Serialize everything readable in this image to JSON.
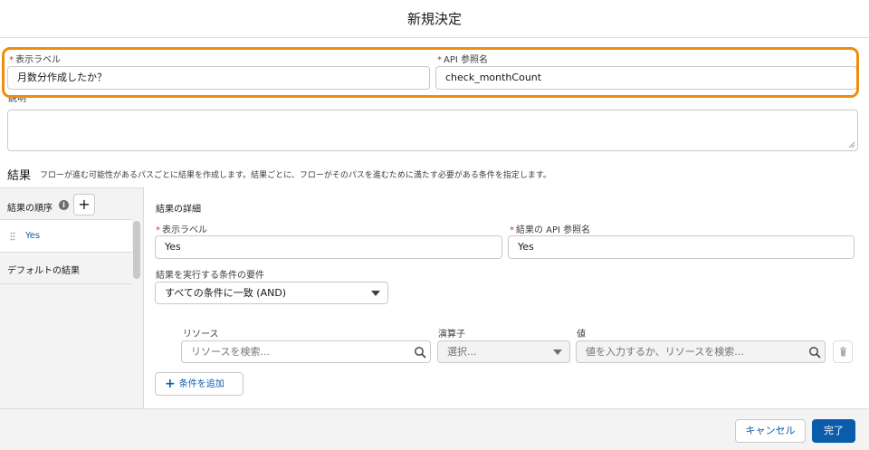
{
  "modal": {
    "title": "新規決定"
  },
  "fields": {
    "label": {
      "label": "表示ラベル",
      "value": "月数分作成したか？"
    },
    "api_name": {
      "label": "API 参照名",
      "value": "check_monthCount"
    },
    "description": {
      "label": "説明",
      "value": ""
    }
  },
  "outcomes_section": {
    "title": "結果",
    "description": "フローが進む可能性があるパスごとに結果を作成します。結果ごとに、フローがそのパスを進むために満たす必要がある条件を指定します。"
  },
  "outcome_list": {
    "order_label": "結果の順序",
    "info_icon": "i",
    "add_label": "+",
    "items": [
      "Yes",
      "デフォルトの結果"
    ]
  },
  "outcome_detail": {
    "title": "結果の詳細",
    "label_field": {
      "label": "表示ラベル",
      "value": "Yes"
    },
    "api_field": {
      "label": "結果の API 参照名",
      "value": "Yes"
    },
    "condition_requirement": {
      "label": "結果を実行する条件の要件",
      "value": "すべての条件に一致 (AND)"
    },
    "condition": {
      "resource_label": "リソース",
      "resource_placeholder": "リソースを検索...",
      "operator_label": "演算子",
      "operator_value": "選択...",
      "value_label": "値",
      "value_placeholder": "値を入力するか、リソースを検索..."
    },
    "add_condition_label": "条件を追加"
  },
  "footer": {
    "cancel_label": "キャンセル",
    "done_label": "完了"
  },
  "colors": {
    "highlight": "#f08c0e",
    "brand": "#0b5cab",
    "required": "#c23934"
  },
  "icons": [
    "info-icon",
    "add-icon",
    "drag-handle-icon",
    "search-icon",
    "chevron-down-icon",
    "trash-icon",
    "plus-icon",
    "resize-grip-icon"
  ]
}
